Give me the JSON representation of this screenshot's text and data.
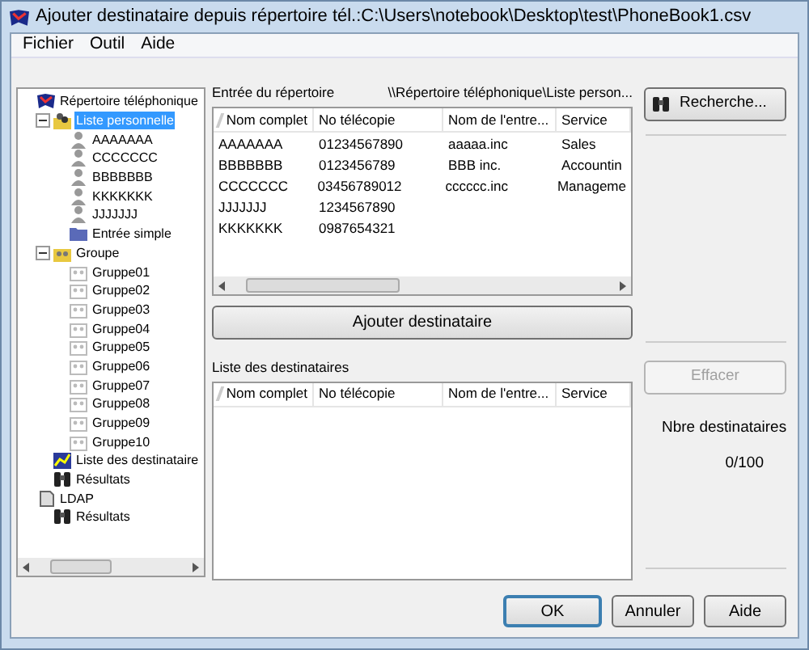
{
  "window": {
    "title": "Ajouter destinataire depuis répertoire tél.:C:\\Users\\notebook\\Desktop\\test\\PhoneBook1.csv"
  },
  "menu": [
    "Fichier",
    "Outil",
    "Aide"
  ],
  "tree": [
    {
      "label": "Répertoire téléphonique",
      "kind": "book",
      "selected": false,
      "children": [
        {
          "label": "Liste personnelle",
          "kind": "people",
          "selected": true,
          "expanded": true,
          "children": [
            {
              "label": "AAAAAAA",
              "kind": "person",
              "selected": false
            },
            {
              "label": "CCCCCCC",
              "kind": "person",
              "selected": false
            },
            {
              "label": "BBBBBBB",
              "kind": "person",
              "selected": false
            },
            {
              "label": "KKKKKKK",
              "kind": "person",
              "selected": false
            },
            {
              "label": "JJJJJJJ",
              "kind": "person",
              "selected": false
            },
            {
              "label": "Entrée simple",
              "kind": "folder",
              "selected": false
            }
          ]
        },
        {
          "label": "Groupe",
          "kind": "groups",
          "selected": false,
          "expanded": true,
          "children": [
            {
              "label": "Gruppe01",
              "kind": "group",
              "selected": false
            },
            {
              "label": "Gruppe02",
              "kind": "group",
              "selected": false
            },
            {
              "label": "Gruppe03",
              "kind": "group",
              "selected": false
            },
            {
              "label": "Gruppe04",
              "kind": "group",
              "selected": false
            },
            {
              "label": "Gruppe05",
              "kind": "group",
              "selected": false
            },
            {
              "label": "Gruppe06",
              "kind": "group",
              "selected": false
            },
            {
              "label": "Gruppe07",
              "kind": "group",
              "selected": false
            },
            {
              "label": "Gruppe08",
              "kind": "group",
              "selected": false
            },
            {
              "label": "Gruppe09",
              "kind": "group",
              "selected": false
            },
            {
              "label": "Gruppe10",
              "kind": "group",
              "selected": false
            }
          ]
        },
        {
          "label": "Liste des destinataire",
          "kind": "list",
          "selected": false
        },
        {
          "label": "Résultats",
          "kind": "results",
          "selected": false
        }
      ]
    },
    {
      "label": "LDAP",
      "kind": "server",
      "selected": false,
      "children": [
        {
          "label": "Résultats",
          "kind": "results",
          "selected": false
        }
      ]
    }
  ],
  "directory": {
    "label": "Entrée du répertoire",
    "path": "\\\\Répertoire téléphonique\\Liste person...",
    "columns": [
      "Nom complet",
      "No télécopie",
      "Nom de l'entre...",
      "Service"
    ],
    "rows": [
      [
        "AAAAAAA",
        "01234567890",
        "aaaaa.inc",
        "Sales"
      ],
      [
        "BBBBBBB",
        "0123456789",
        "BBB inc.",
        "Accountin"
      ],
      [
        "CCCCCCC",
        "03456789012",
        "cccccc.inc",
        "Manageme"
      ],
      [
        "JJJJJJJ",
        "1234567890",
        "",
        ""
      ],
      [
        "KKKKKKK",
        "0987654321",
        "",
        ""
      ]
    ]
  },
  "add_button": {
    "label": "Ajouter destinataire",
    "disabled": false
  },
  "recipients": {
    "label": "Liste des destinataires",
    "columns": [
      "Nom complet",
      "No télécopie",
      "Nom de l'entre...",
      "Service"
    ]
  },
  "search_button": {
    "label": "Recherche...",
    "disabled": false
  },
  "clear_button": {
    "label": "Effacer",
    "disabled": true
  },
  "count": {
    "label": "Nbre destinataires",
    "value": "0/100"
  },
  "buttons": [
    {
      "label": "OK",
      "default": true
    },
    {
      "label": "Annuler",
      "default": false
    },
    {
      "label": "Aide",
      "default": false
    }
  ]
}
